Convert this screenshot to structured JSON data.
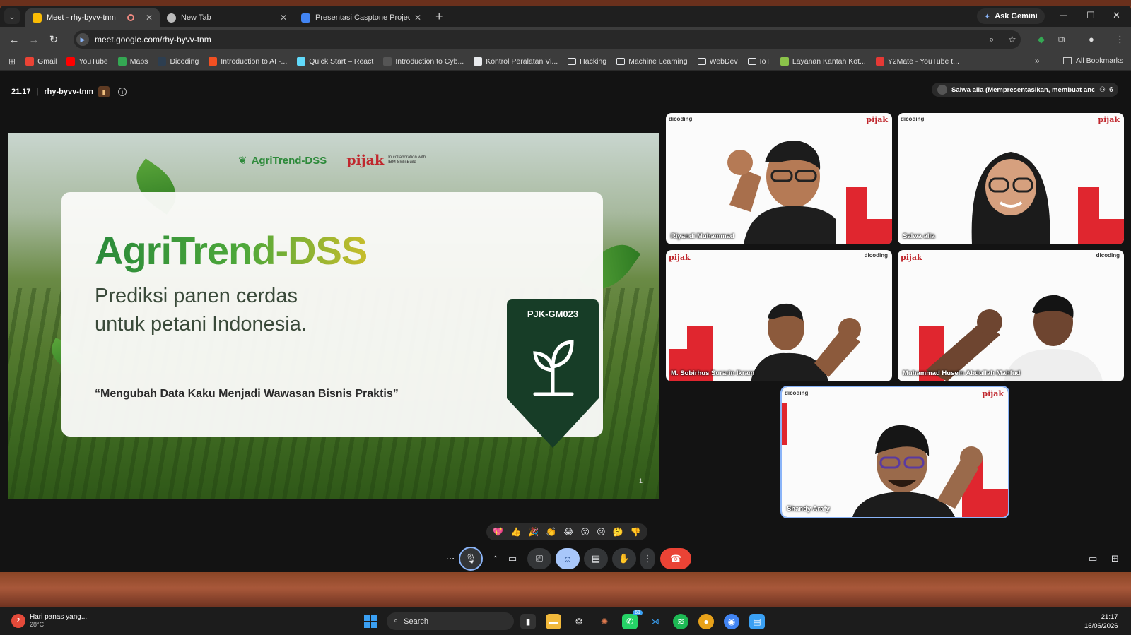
{
  "browser": {
    "tabs": [
      {
        "title": "Meet - rhy-byvv-tnm",
        "active": true,
        "recording": true
      },
      {
        "title": "New Tab",
        "active": false
      },
      {
        "title": "Presentasi Casptone Project PJK",
        "active": false
      }
    ],
    "new_tab_label": "+",
    "ask_gemini": "Ask Gemini",
    "url": "meet.google.com/rhy-byvv-tnm",
    "bookmarks": [
      {
        "label": "Gmail",
        "icon": "gmail-icon",
        "color": "#ea4335"
      },
      {
        "label": "YouTube",
        "icon": "youtube-icon",
        "color": "#ff0000"
      },
      {
        "label": "Maps",
        "icon": "maps-icon",
        "color": "#34a853"
      },
      {
        "label": "Dicoding",
        "icon": "dicoding-icon",
        "color": "#2d3e50"
      },
      {
        "label": "Introduction to AI -...",
        "icon": "microsoft-icon",
        "color": "#f25022"
      },
      {
        "label": "Quick Start – React",
        "icon": "react-icon",
        "color": "#61dafb"
      },
      {
        "label": "Introduction to Cyb...",
        "icon": "cyber-icon",
        "color": "#555555"
      },
      {
        "label": "Kontrol Peralatan Vi...",
        "icon": "doc-icon",
        "color": "#e8eaed"
      },
      {
        "label": "Hacking",
        "icon": "folder-icon",
        "color": "#e8eaed"
      },
      {
        "label": "Machine Learning",
        "icon": "folder-icon",
        "color": "#e8eaed"
      },
      {
        "label": "WebDev",
        "icon": "folder-icon",
        "color": "#e8eaed"
      },
      {
        "label": "IoT",
        "icon": "folder-icon",
        "color": "#e8eaed"
      },
      {
        "label": "Layanan Kantah Kot...",
        "icon": "gov-icon",
        "color": "#8bc34a"
      },
      {
        "label": "Y2Mate - YouTube t...",
        "icon": "y2mate-icon",
        "color": "#e53935"
      }
    ],
    "more_bookmarks": "»",
    "all_bookmarks": "All Bookmarks"
  },
  "meet": {
    "time": "21.17",
    "meeting_code": "rhy-byvv-tnm",
    "presenting_label": "Salwa alia (Mempresentasikan, membuat anotasi)",
    "participant_count": "6",
    "slide": {
      "logo_agri": "AgriTrend-DSS",
      "logo_pijak": "pijak",
      "logo_ibm": "In collaboration with IBM SkillsBuild",
      "title": "AgriTrend-DSS",
      "subtitle_line1": "Prediksi panen cerdas",
      "subtitle_line2": "untuk petani Indonesia.",
      "quote": "“Mengubah Data Kaku Menjadi Wawasan Bisnis Praktis”",
      "badge_code": "PJK-GM023",
      "page_number": "1"
    },
    "participants": [
      {
        "name": "Riyandi Muhammad",
        "brand_left": "dicoding",
        "brand_right": "pijak"
      },
      {
        "name": "Salwa alia",
        "brand_left": "dicoding",
        "brand_right": "pijak"
      },
      {
        "name": "M. Sobirhus Surarin Ikram",
        "brand_left": "pijak",
        "brand_right": "dicoding"
      },
      {
        "name": "Muhammad Husein Abdullah Mahfud",
        "brand_left": "pijak",
        "brand_right": "dicoding"
      },
      {
        "name": "Shandy Arafy",
        "brand_left": "dicoding",
        "brand_right": "pijak"
      }
    ],
    "reactions": [
      "💖",
      "👍",
      "🎉",
      "👏",
      "😂",
      "😮",
      "😢",
      "🤔",
      "👎"
    ]
  },
  "taskbar": {
    "weather_text": "Hari panas yang...",
    "temperature": "28°C",
    "weather_badge": "2",
    "search_placeholder": "Search",
    "whatsapp_badge": "61",
    "clock_time": "21:17",
    "clock_date": "16/06/2026"
  }
}
